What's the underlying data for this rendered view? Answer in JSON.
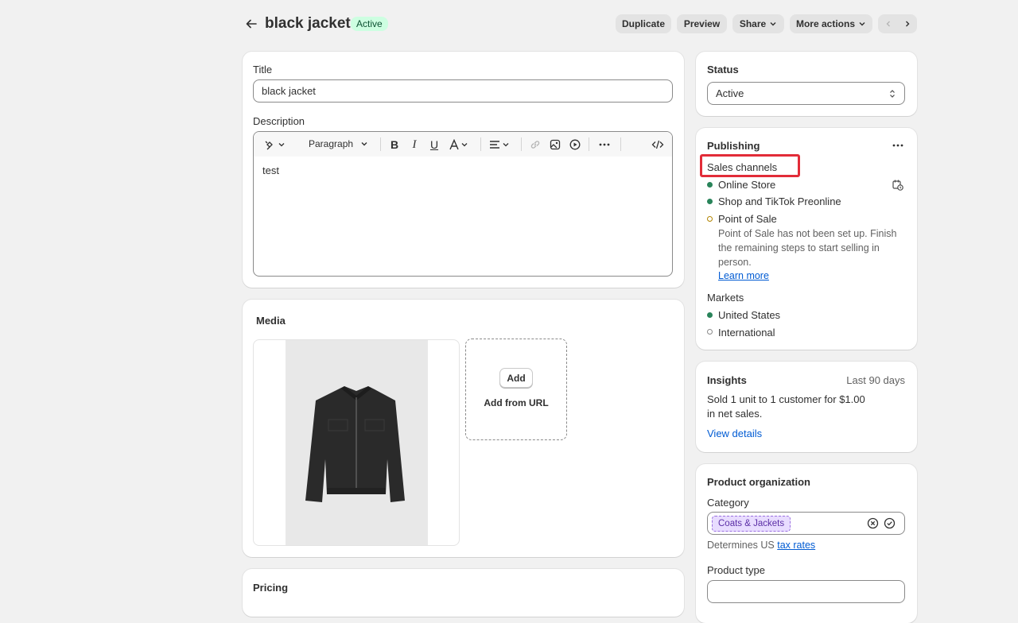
{
  "header": {
    "title": "black jacket",
    "status_badge": "Active",
    "buttons": {
      "duplicate": "Duplicate",
      "preview": "Preview",
      "share": "Share",
      "more_actions": "More actions"
    }
  },
  "main": {
    "title_label": "Title",
    "title_value": "black jacket",
    "description_label": "Description",
    "paragraph_select": "Paragraph",
    "description_text": "test",
    "media": {
      "heading": "Media",
      "add_button": "Add",
      "add_from_url": "Add from URL"
    },
    "pricing_heading": "Pricing"
  },
  "sidebar": {
    "status": {
      "heading": "Status",
      "value": "Active"
    },
    "publishing": {
      "heading": "Publishing",
      "sales_channels_label": "Sales channels",
      "channels": [
        {
          "name": "Online Store",
          "state": "active"
        },
        {
          "name": "Shop and TikTok Preonline",
          "state": "active"
        },
        {
          "name": "Point of Sale",
          "state": "pending"
        }
      ],
      "pos_note": "Point of Sale has not been set up. Finish the remaining steps to start selling in person.",
      "learn_more": "Learn more",
      "markets_label": "Markets",
      "markets": [
        {
          "name": "United States",
          "state": "active"
        },
        {
          "name": "International",
          "state": "inactive"
        }
      ]
    },
    "insights": {
      "heading": "Insights",
      "period": "Last 90 days",
      "summary": "Sold 1 unit to 1 customer for $1.00 in net sales.",
      "view_details": "View details"
    },
    "organization": {
      "heading": "Product organization",
      "category_label": "Category",
      "category_value": "Coats & Jackets",
      "determines_text": "Determines US",
      "tax_rates_link": "tax rates",
      "product_type_label": "Product type"
    }
  },
  "colors": {
    "active_dot": "#29845a",
    "pending_dot": "#b28400",
    "highlight_box": "#e22c38",
    "link": "#005bd3"
  }
}
